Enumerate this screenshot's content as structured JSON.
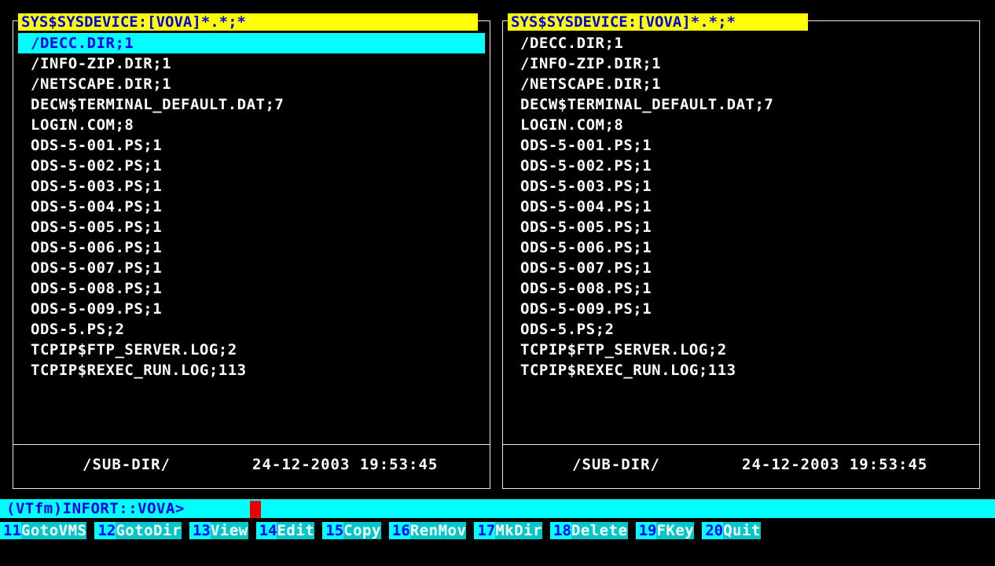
{
  "panels": [
    {
      "title": "SYS$SYSDEVICE:[VOVA]*.*;*",
      "files": [
        "/DECC.DIR;1",
        "/INFO-ZIP.DIR;1",
        "/NETSCAPE.DIR;1",
        "DECW$TERMINAL_DEFAULT.DAT;7",
        "LOGIN.COM;8",
        "ODS-5-001.PS;1",
        "ODS-5-002.PS;1",
        "ODS-5-003.PS;1",
        "ODS-5-004.PS;1",
        "ODS-5-005.PS;1",
        "ODS-5-006.PS;1",
        "ODS-5-007.PS;1",
        "ODS-5-008.PS;1",
        "ODS-5-009.PS;1",
        "ODS-5.PS;2",
        "TCPIP$FTP_SERVER.LOG;2",
        "TCPIP$REXEC_RUN.LOG;113"
      ],
      "selected_index": 0,
      "status": {
        "name": "/SUB-DIR/",
        "datetime": "24-12-2003 19:53:45"
      }
    },
    {
      "title": "SYS$SYSDEVICE:[VOVA]*.*;*",
      "files": [
        "/DECC.DIR;1",
        "/INFO-ZIP.DIR;1",
        "/NETSCAPE.DIR;1",
        "DECW$TERMINAL_DEFAULT.DAT;7",
        "LOGIN.COM;8",
        "ODS-5-001.PS;1",
        "ODS-5-002.PS;1",
        "ODS-5-003.PS;1",
        "ODS-5-004.PS;1",
        "ODS-5-005.PS;1",
        "ODS-5-006.PS;1",
        "ODS-5-007.PS;1",
        "ODS-5-008.PS;1",
        "ODS-5-009.PS;1",
        "ODS-5.PS;2",
        "TCPIP$FTP_SERVER.LOG;2",
        "TCPIP$REXEC_RUN.LOG;113"
      ],
      "selected_index": -1,
      "status": {
        "name": "/SUB-DIR/",
        "datetime": "24-12-2003 19:53:45"
      }
    }
  ],
  "prompt": {
    "text": "(VTfm)INFORT::VOVA>"
  },
  "function_keys": [
    {
      "num": "11",
      "label": "GotoVMS"
    },
    {
      "num": "12",
      "label": "GotoDir"
    },
    {
      "num": "13",
      "label": "View"
    },
    {
      "num": "14",
      "label": "Edit"
    },
    {
      "num": "15",
      "label": "Copy"
    },
    {
      "num": "16",
      "label": "RenMov"
    },
    {
      "num": "17",
      "label": "MkDir"
    },
    {
      "num": "18",
      "label": "Delete"
    },
    {
      "num": "19",
      "label": "FKey"
    },
    {
      "num": "20",
      "label": "Quit"
    }
  ],
  "colors": {
    "title_bg": "#ffff00",
    "title_fg": "#0000e0",
    "selection_bg": "#00ffff",
    "selection_fg": "#0000e0",
    "cursor": "#ee0000"
  }
}
